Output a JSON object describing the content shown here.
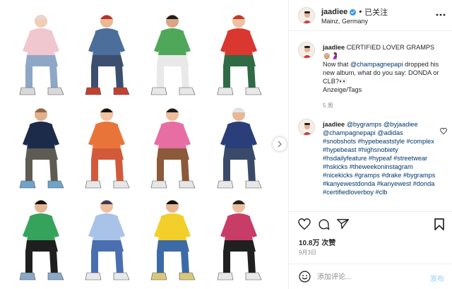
{
  "post": {
    "username": "jaadiee",
    "follow_separator": "•",
    "follow_label": "已关注",
    "location": "Mainz, Germany",
    "more_icon": "more-horizontal-icon",
    "image": {
      "carousel_next_icon": "chevron-right-icon",
      "tiles": [
        {
          "top": "#f0c6cf",
          "bottom": "#8fa7c7",
          "shoe": "#d9d9d9",
          "hat": "#e8d5d5",
          "skin": "#f1cdb4"
        },
        {
          "top": "#4b6f9a",
          "bottom": "#3c4f6e",
          "shoe": "#c2402f",
          "hat": "#b9302a",
          "skin": "#e9b993"
        },
        {
          "top": "#4fa85a",
          "bottom": "#e9e9e9",
          "shoe": "#e8e8e8",
          "hat": "#1e1e1e",
          "skin": "#d9a583"
        },
        {
          "top": "#d9372f",
          "bottom": "#2f6b45",
          "shoe": "#e8e8e8",
          "hat": "#c43a2a",
          "skin": "#eec1a0"
        },
        {
          "top": "#1d2b4a",
          "bottom": "#5e5c52",
          "shoe": "#6fa3c9",
          "hat": "#8a6b45",
          "skin": "#e2b08c"
        },
        {
          "top": "#e9743a",
          "bottom": "#d25a3a",
          "shoe": "#e7e7e7",
          "hat": "#111111",
          "skin": "#f0c3a3"
        },
        {
          "top": "#e66ea2",
          "bottom": "#8a5a3a",
          "shoe": "#e6e6e6",
          "hat": "#1e1e1e",
          "skin": "#edbd9c"
        },
        {
          "top": "#2a3f7a",
          "bottom": "#3a4a6a",
          "shoe": "#e8e8e8",
          "hat": "#e6e6e6",
          "skin": "#e8b896"
        },
        {
          "top": "#36a35d",
          "bottom": "#1f1f1f",
          "shoe": "#8aa8c8",
          "hat": "#111111",
          "skin": "#e5b595"
        },
        {
          "top": "#a9c3e8",
          "bottom": "#4a6fb0",
          "shoe": "#e8e8e8",
          "hat": "#3b3b55",
          "skin": "#eec0a0"
        },
        {
          "top": "#f2cf2a",
          "bottom": "#3c6aa6",
          "shoe": "#d8c87a",
          "hat": "#111111",
          "skin": "#e7b794"
        },
        {
          "top": "#c83c68",
          "bottom": "#202020",
          "shoe": "#e8e8e8",
          "hat": "#222222",
          "skin": "#eebf9e"
        }
      ]
    }
  },
  "comments": [
    {
      "username": "jaadiee",
      "text": "CERTIFIED LOVER GRAMPS",
      "emojis": "👴🏼🤰🏽",
      "body": "Now that ",
      "mention": "@champagnepapi",
      "body2": " dropped his new album, what do you say: DONDA or CLB?👀",
      "ad": "Anzeige/Tags",
      "timestamp": "5 周"
    },
    {
      "username": "jaadiee",
      "tags": "@bygramps @byjaadiee @champagnepapi @adidas #snobshots #hypebeaststyle #complex #hypebeast #highsnobiety #hsdailyfeature #hypeaf #streetwear #hskicks #theweekoninstagram #nicekicks #gramps #drake #bygramps #kanyewestdonda #kanyewest #donda #certifiedloverboy #clb",
      "like_icon": "heart-outline-icon"
    }
  ],
  "actions": {
    "like_icon": "heart-outline-icon",
    "comment_icon": "comment-bubble-icon",
    "share_icon": "paper-plane-icon",
    "save_icon": "bookmark-icon"
  },
  "likes": "10.8万 次赞",
  "date": "9月3日",
  "composer": {
    "emoji_icon": "smiley-icon",
    "placeholder": "添加评论...",
    "post_label": "发布"
  },
  "colors": {
    "link": "#00376b",
    "verified": "#3897f0",
    "muted": "#8e8e8e",
    "post_disabled": "#b2dffc"
  }
}
